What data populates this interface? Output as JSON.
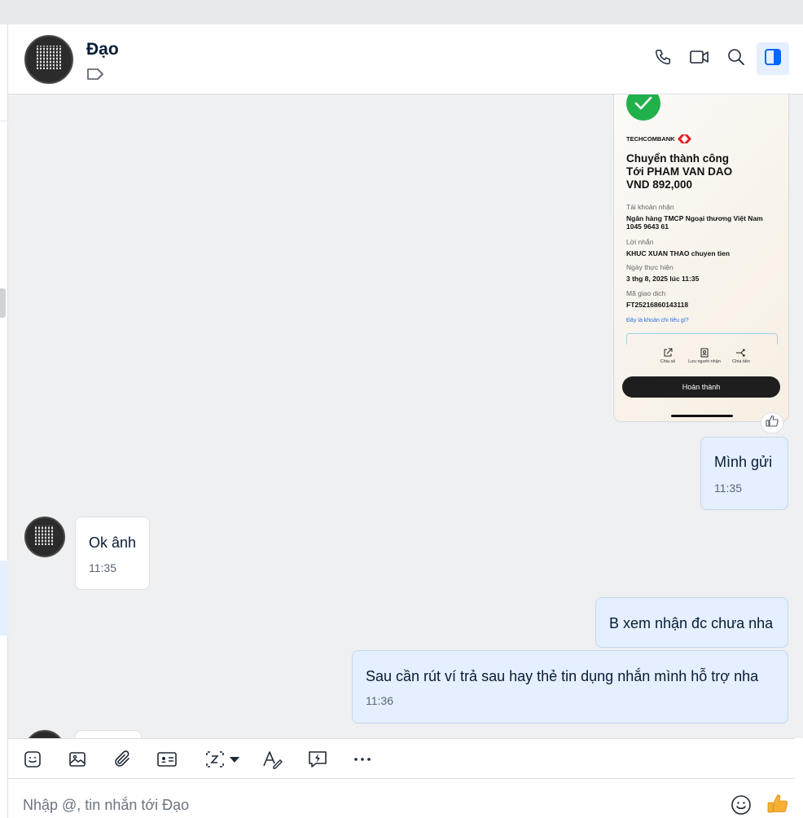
{
  "header": {
    "contact_name": "Đạo",
    "actions": [
      "phone-icon",
      "video-call-icon",
      "search-icon",
      "sidebar-toggle-icon"
    ]
  },
  "receipt": {
    "bank": "TECHCOMBANK",
    "title_line1": "Chuyển thành công",
    "title_line2": "Tới PHAM VAN DAO",
    "amount": "VND 892,000",
    "account_label": "Tài khoản nhận",
    "account_bank": "Ngân hàng TMCP Ngoại thương Việt Nam",
    "account_number": "1045 9643 61",
    "message_label": "Lời nhắn",
    "message_value": "KHUC XUAN THAO chuyen tien",
    "date_label": "Ngày thực hiện",
    "date_value": "3 thg 8, 2025 lúc 11:35",
    "txn_label": "Mã giao dịch",
    "txn_value": "FT25216860143118",
    "link": "Đây là khoản chi tiêu gì?",
    "actions": [
      "Chia sẻ",
      "Lưu người nhận",
      "Chia tiền"
    ],
    "done_button": "Hoàn thành"
  },
  "messages": [
    {
      "from": "me",
      "text": "Mình gửi",
      "time": "11:35"
    },
    {
      "from": "them",
      "text": "Ok ânh",
      "time": "11:35"
    },
    {
      "from": "me",
      "text": "B xem nhận đc chưa nha",
      "time": ""
    },
    {
      "from": "me",
      "text": "Sau cần rút ví trả sau hay thẻ tin dụng nhắn mình hỗ trợ nha",
      "time": "11:36"
    }
  ],
  "toolbar": {
    "icons": [
      "sticker-icon",
      "image-icon",
      "attachment-icon",
      "contact-card-icon",
      "screenshot-icon",
      "format-text-icon",
      "quick-message-icon",
      "more-icon"
    ]
  },
  "composer": {
    "placeholder": "Nhập @, tin nhắn tới Đạo"
  }
}
